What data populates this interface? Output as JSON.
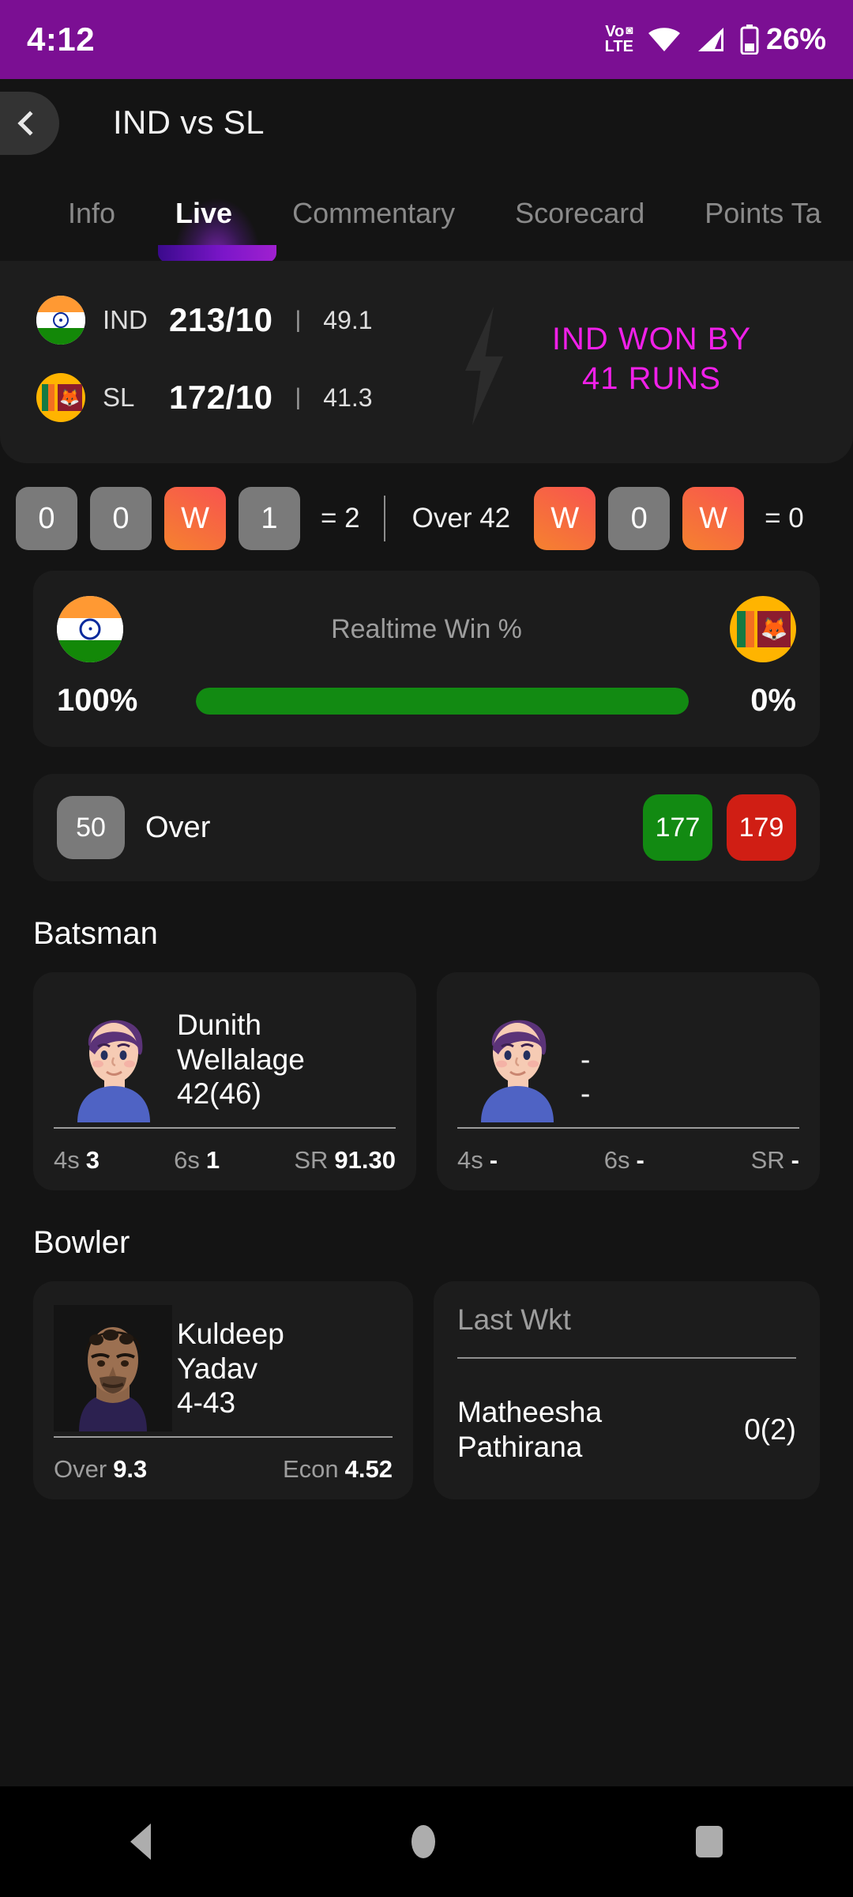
{
  "status_bar": {
    "time": "4:12",
    "network_label_top": "Vo",
    "network_label_bottom": "LTE",
    "battery_percent": "26%",
    "icons": [
      "volte-icon",
      "wifi-icon",
      "cellular-signal-icon",
      "battery-icon"
    ]
  },
  "header": {
    "back_icon": "chevron-left-icon",
    "title": "IND vs SL"
  },
  "tabs": {
    "items": [
      {
        "label": "Info",
        "active": false
      },
      {
        "label": "Live",
        "active": true
      },
      {
        "label": "Commentary",
        "active": false
      },
      {
        "label": "Scorecard",
        "active": false
      },
      {
        "label": "Points Ta",
        "active": false
      }
    ],
    "active_color": "#a020d0"
  },
  "scoreboard": {
    "teams": [
      {
        "code": "IND",
        "flag": "india-flag-icon",
        "runs": "213/10",
        "sep": "|",
        "overs": "49.1"
      },
      {
        "code": "SL",
        "flag": "srilanka-flag-icon",
        "runs": "172/10",
        "sep": "|",
        "overs": "41.3"
      }
    ],
    "result_line1": "IND WON BY",
    "result_line2": "41 RUNS",
    "result_color": "#F020E8",
    "bolt_icon": "lightning-bolt-icon"
  },
  "ball_strip": {
    "prev_over_balls": [
      {
        "label": "0",
        "type": "dot"
      },
      {
        "label": "0",
        "type": "dot"
      },
      {
        "label": "W",
        "type": "wicket"
      },
      {
        "label": "1",
        "type": "dot"
      }
    ],
    "prev_over_total": "= 2",
    "over_label": "Over 42",
    "current_over_balls": [
      {
        "label": "W",
        "type": "wicket"
      },
      {
        "label": "0",
        "type": "dot"
      },
      {
        "label": "W",
        "type": "wicket"
      }
    ],
    "current_over_total": "= 0"
  },
  "win_percent": {
    "title": "Realtime Win %",
    "left_flag": "india-flag-icon",
    "right_flag": "srilanka-flag-icon",
    "left_value": "100%",
    "right_value": "0%",
    "fill_percent": 100,
    "bar_color": "#128A12"
  },
  "over_card": {
    "badge": "50",
    "label": "Over",
    "green_value": "177",
    "red_value": "179",
    "green_color": "#128A12",
    "red_color": "#D01E14"
  },
  "batsman": {
    "section_title": "Batsman",
    "players": [
      {
        "name_line1": "Dunith",
        "name_line2": "Wellalage",
        "score": "42(46)",
        "stats": [
          {
            "label": "4s",
            "value": "3"
          },
          {
            "label": "6s",
            "value": "1"
          },
          {
            "label": "SR",
            "value": "91.30"
          }
        ]
      },
      {
        "name_line1": "-",
        "name_line2": "-",
        "score": "",
        "stats": [
          {
            "label": "4s",
            "value": "-"
          },
          {
            "label": "6s",
            "value": "-"
          },
          {
            "label": "SR",
            "value": "-"
          }
        ]
      }
    ]
  },
  "bowler": {
    "section_title": "Bowler",
    "player": {
      "name_line1": "Kuldeep",
      "name_line2": "Yadav",
      "figures": "4-43",
      "stats": [
        {
          "label": "Over",
          "value": "9.3"
        },
        {
          "label": "Econ",
          "value": "4.52"
        }
      ]
    },
    "last_wicket": {
      "title": "Last Wkt",
      "name_line1": "Matheesha",
      "name_line2": "Pathirana",
      "score": "0(2)"
    }
  },
  "nav_bar": {
    "back_icon": "nav-back-triangle-icon",
    "home_icon": "nav-home-circle-icon",
    "recents_icon": "nav-recents-square-icon"
  }
}
